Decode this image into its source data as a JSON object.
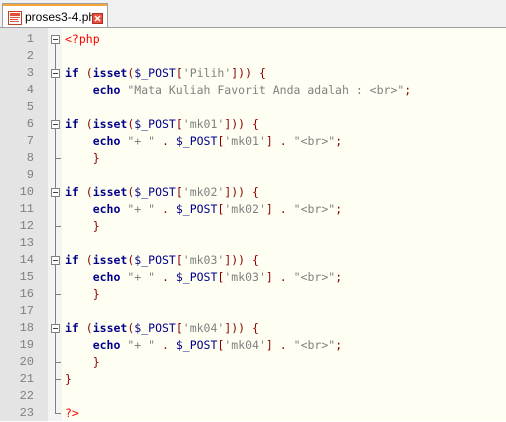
{
  "tab": {
    "file_name": "proses3-4.php",
    "file_icon": "php-file-icon",
    "close_icon": "close-tab-icon",
    "accent_color": "#f7a53a"
  },
  "editor": {
    "line_numbers": [
      "1",
      "2",
      "3",
      "4",
      "5",
      "6",
      "7",
      "8",
      "9",
      "10",
      "11",
      "12",
      "13",
      "14",
      "15",
      "16",
      "17",
      "18",
      "19",
      "20",
      "21",
      "22",
      "23"
    ],
    "lines": [
      [
        {
          "t": "<?php",
          "c": "php"
        }
      ],
      [],
      [
        {
          "t": "if",
          "c": "kw"
        },
        {
          "t": " "
        },
        {
          "t": "(",
          "c": "op"
        },
        {
          "t": "isset",
          "c": "kw"
        },
        {
          "t": "(",
          "c": "op"
        },
        {
          "t": "$_POST",
          "c": "fn"
        },
        {
          "t": "[",
          "c": "op"
        },
        {
          "t": "'Pilih'",
          "c": "str"
        },
        {
          "t": "]))",
          "c": "op"
        },
        {
          "t": " "
        },
        {
          "t": "{",
          "c": "op"
        }
      ],
      [
        {
          "t": "    "
        },
        {
          "t": "echo",
          "c": "kw"
        },
        {
          "t": " "
        },
        {
          "t": "\"Mata Kuliah Favorit Anda adalah : <br>\"",
          "c": "str"
        },
        {
          "t": ";",
          "c": "op"
        }
      ],
      [],
      [
        {
          "t": "if",
          "c": "kw"
        },
        {
          "t": " "
        },
        {
          "t": "(",
          "c": "op"
        },
        {
          "t": "isset",
          "c": "kw"
        },
        {
          "t": "(",
          "c": "op"
        },
        {
          "t": "$_POST",
          "c": "fn"
        },
        {
          "t": "[",
          "c": "op"
        },
        {
          "t": "'mk01'",
          "c": "str"
        },
        {
          "t": "]))",
          "c": "op"
        },
        {
          "t": " "
        },
        {
          "t": "{",
          "c": "op"
        }
      ],
      [
        {
          "t": "    "
        },
        {
          "t": "echo",
          "c": "kw"
        },
        {
          "t": " "
        },
        {
          "t": "\"+ \"",
          "c": "str"
        },
        {
          "t": " "
        },
        {
          "t": ".",
          "c": "op"
        },
        {
          "t": " "
        },
        {
          "t": "$_POST",
          "c": "fn"
        },
        {
          "t": "[",
          "c": "op"
        },
        {
          "t": "'mk01'",
          "c": "str"
        },
        {
          "t": "]",
          "c": "op"
        },
        {
          "t": " "
        },
        {
          "t": ".",
          "c": "op"
        },
        {
          "t": " "
        },
        {
          "t": "\"<br>\"",
          "c": "str"
        },
        {
          "t": ";",
          "c": "op"
        }
      ],
      [
        {
          "t": "    "
        },
        {
          "t": "}",
          "c": "op"
        }
      ],
      [],
      [
        {
          "t": "if",
          "c": "kw"
        },
        {
          "t": " "
        },
        {
          "t": "(",
          "c": "op"
        },
        {
          "t": "isset",
          "c": "kw"
        },
        {
          "t": "(",
          "c": "op"
        },
        {
          "t": "$_POST",
          "c": "fn"
        },
        {
          "t": "[",
          "c": "op"
        },
        {
          "t": "'mk02'",
          "c": "str"
        },
        {
          "t": "]))",
          "c": "op"
        },
        {
          "t": " "
        },
        {
          "t": "{",
          "c": "op"
        }
      ],
      [
        {
          "t": "    "
        },
        {
          "t": "echo",
          "c": "kw"
        },
        {
          "t": " "
        },
        {
          "t": "\"+ \"",
          "c": "str"
        },
        {
          "t": " "
        },
        {
          "t": ".",
          "c": "op"
        },
        {
          "t": " "
        },
        {
          "t": "$_POST",
          "c": "fn"
        },
        {
          "t": "[",
          "c": "op"
        },
        {
          "t": "'mk02'",
          "c": "str"
        },
        {
          "t": "]",
          "c": "op"
        },
        {
          "t": " "
        },
        {
          "t": ".",
          "c": "op"
        },
        {
          "t": " "
        },
        {
          "t": "\"<br>\"",
          "c": "str"
        },
        {
          "t": ";",
          "c": "op"
        }
      ],
      [
        {
          "t": "    "
        },
        {
          "t": "}",
          "c": "op"
        }
      ],
      [],
      [
        {
          "t": "if",
          "c": "kw"
        },
        {
          "t": " "
        },
        {
          "t": "(",
          "c": "op"
        },
        {
          "t": "isset",
          "c": "kw"
        },
        {
          "t": "(",
          "c": "op"
        },
        {
          "t": "$_POST",
          "c": "fn"
        },
        {
          "t": "[",
          "c": "op"
        },
        {
          "t": "'mk03'",
          "c": "str"
        },
        {
          "t": "]))",
          "c": "op"
        },
        {
          "t": " "
        },
        {
          "t": "{",
          "c": "op"
        }
      ],
      [
        {
          "t": "    "
        },
        {
          "t": "echo",
          "c": "kw"
        },
        {
          "t": " "
        },
        {
          "t": "\"+ \"",
          "c": "str"
        },
        {
          "t": " "
        },
        {
          "t": ".",
          "c": "op"
        },
        {
          "t": " "
        },
        {
          "t": "$_POST",
          "c": "fn"
        },
        {
          "t": "[",
          "c": "op"
        },
        {
          "t": "'mk03'",
          "c": "str"
        },
        {
          "t": "]",
          "c": "op"
        },
        {
          "t": " "
        },
        {
          "t": ".",
          "c": "op"
        },
        {
          "t": " "
        },
        {
          "t": "\"<br>\"",
          "c": "str"
        },
        {
          "t": ";",
          "c": "op"
        }
      ],
      [
        {
          "t": "    "
        },
        {
          "t": "}",
          "c": "op"
        }
      ],
      [],
      [
        {
          "t": "if",
          "c": "kw"
        },
        {
          "t": " "
        },
        {
          "t": "(",
          "c": "op"
        },
        {
          "t": "isset",
          "c": "kw"
        },
        {
          "t": "(",
          "c": "op"
        },
        {
          "t": "$_POST",
          "c": "fn"
        },
        {
          "t": "[",
          "c": "op"
        },
        {
          "t": "'mk04'",
          "c": "str"
        },
        {
          "t": "]))",
          "c": "op"
        },
        {
          "t": " "
        },
        {
          "t": "{",
          "c": "op"
        }
      ],
      [
        {
          "t": "    "
        },
        {
          "t": "echo",
          "c": "kw"
        },
        {
          "t": " "
        },
        {
          "t": "\"+ \"",
          "c": "str"
        },
        {
          "t": " "
        },
        {
          "t": ".",
          "c": "op"
        },
        {
          "t": " "
        },
        {
          "t": "$_POST",
          "c": "fn"
        },
        {
          "t": "[",
          "c": "op"
        },
        {
          "t": "'mk04'",
          "c": "str"
        },
        {
          "t": "]",
          "c": "op"
        },
        {
          "t": " "
        },
        {
          "t": ".",
          "c": "op"
        },
        {
          "t": " "
        },
        {
          "t": "\"<br>\"",
          "c": "str"
        },
        {
          "t": ";",
          "c": "op"
        }
      ],
      [
        {
          "t": "    "
        },
        {
          "t": "}",
          "c": "op"
        }
      ],
      [
        {
          "t": "}",
          "c": "op"
        }
      ],
      [],
      [
        {
          "t": "?>",
          "c": "php"
        }
      ]
    ]
  }
}
